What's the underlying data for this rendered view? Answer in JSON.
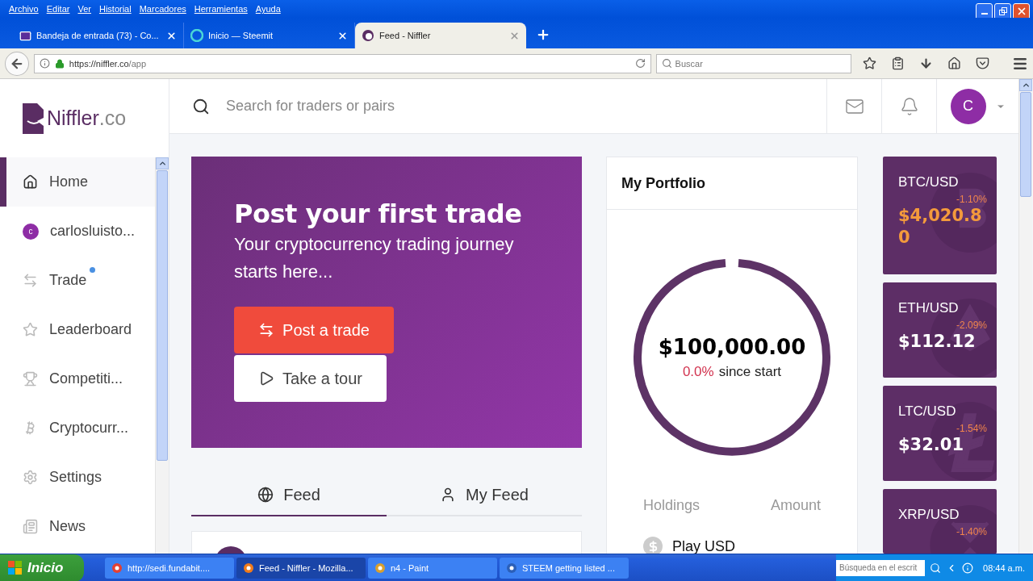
{
  "menu_bar": [
    "Archivo",
    "Editar",
    "Ver",
    "Historial",
    "Marcadores",
    "Herramientas",
    "Ayuda"
  ],
  "browser_tabs": [
    {
      "title": "Bandeja de entrada (73) - Co...",
      "kind": "mail",
      "selected": false
    },
    {
      "title": "Inicio — Steemit",
      "kind": "steemit",
      "selected": false
    },
    {
      "title": "Feed - Niffler",
      "kind": "niffler",
      "selected": true
    }
  ],
  "address_bar": {
    "url_host": "https://niffler.co",
    "url_path": "/app"
  },
  "browser_search": {
    "placeholder": "Buscar"
  },
  "logo": {
    "name": "Niffler",
    "suffix": ".co"
  },
  "sidebar": {
    "items": [
      {
        "label": "Home",
        "kind": "home",
        "selected": true,
        "notification": false
      },
      {
        "label": "carlosluisto...",
        "kind": "avatar",
        "avatar": "c",
        "selected": false,
        "notification": false
      },
      {
        "label": "Trade",
        "kind": "trade",
        "selected": false,
        "notification": true
      },
      {
        "label": "Leaderboard",
        "kind": "star",
        "selected": false,
        "notification": false
      },
      {
        "label": "Competiti...",
        "kind": "trophy",
        "selected": false,
        "notification": false
      },
      {
        "label": "Cryptocurr...",
        "kind": "coin",
        "selected": false,
        "notification": false
      },
      {
        "label": "Settings",
        "kind": "settings",
        "selected": false,
        "notification": false
      },
      {
        "label": "News",
        "kind": "news",
        "selected": false,
        "notification": false
      }
    ]
  },
  "header": {
    "search_placeholder": "Search for traders or pairs",
    "avatar": "C"
  },
  "banner": {
    "title": "Post your first trade",
    "subtitle": "Your cryptocurrency trading journey starts here...",
    "buttons": [
      {
        "label": "Post a trade",
        "kind": "primary"
      },
      {
        "label": "Take a tour",
        "kind": "secondary"
      }
    ]
  },
  "feed_tabs": [
    {
      "label": "Feed",
      "kind": "globe",
      "selected": true
    },
    {
      "label": "My Feed",
      "kind": "user",
      "selected": false
    }
  ],
  "portfolio": {
    "title": "My Portfolio",
    "total": "$100,000.00",
    "change": "0.0%",
    "change_label": "since start",
    "columns": [
      "Holdings",
      "Amount"
    ],
    "holdings": [
      {
        "name": "Play USD"
      }
    ]
  },
  "tickers": [
    {
      "pair": "BTC/USD",
      "change": "-1.10%",
      "price": "$4,020.80",
      "color": "#f39a3c",
      "kind": "btc"
    },
    {
      "pair": "ETH/USD",
      "change": "-2.09%",
      "price": "$112.12",
      "color": "#ffffff",
      "kind": "eth"
    },
    {
      "pair": "LTC/USD",
      "change": "-1.54%",
      "price": "$32.01",
      "color": "#ffffff",
      "kind": "ltc"
    },
    {
      "pair": "XRP/USD",
      "change": "-1.40%",
      "kind": "xrp"
    }
  ],
  "taskbar": {
    "start": "Inicio",
    "tasks": [
      {
        "label": "http://sedi.fundabit....",
        "kind": "chrome",
        "selected": false
      },
      {
        "label": "Feed - Niffler - Mozilla...",
        "kind": "firefox",
        "selected": true
      },
      {
        "label": "n4 - Paint",
        "kind": "paint",
        "selected": false
      },
      {
        "label": "STEEM getting listed ...",
        "kind": "word",
        "selected": false
      }
    ],
    "search_placeholder": "Búsqueda en el escrit",
    "clock": "08:44 a.m."
  }
}
